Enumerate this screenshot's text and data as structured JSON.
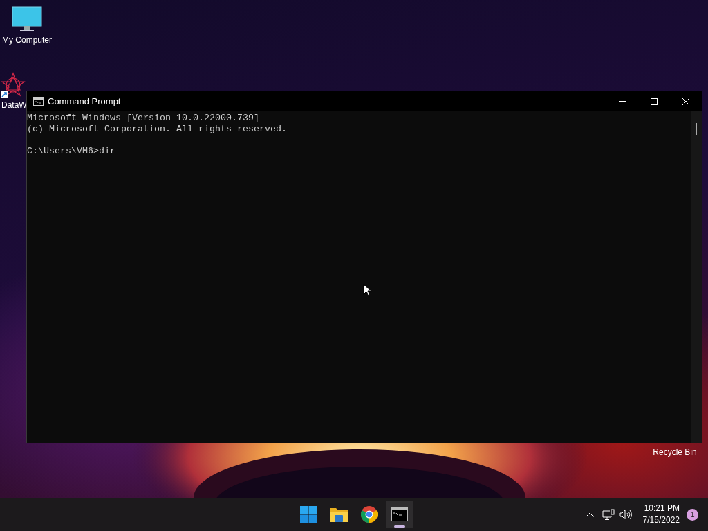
{
  "desktop_icons": [
    {
      "kind": "computer",
      "label": "My Computer"
    },
    {
      "kind": "app",
      "label": "DataW"
    },
    {
      "kind": "recycle",
      "label": "Recycle Bin"
    }
  ],
  "window": {
    "title": "Command Prompt",
    "console_paragraphs": [
      [
        "Microsoft Windows [Version 10.0.22000.739]",
        "(c) Microsoft Corporation. All rights reserved."
      ],
      [
        "C:\\Users\\VM6>dir"
      ]
    ]
  },
  "taskbar": {
    "apps": [
      {
        "kind": "start",
        "active": false
      },
      {
        "kind": "explorer",
        "active": false
      },
      {
        "kind": "browser",
        "active": false
      },
      {
        "kind": "terminal",
        "active": true
      }
    ],
    "time": "10:21 PM",
    "date": "7/15/2022",
    "notification_count": "1"
  }
}
